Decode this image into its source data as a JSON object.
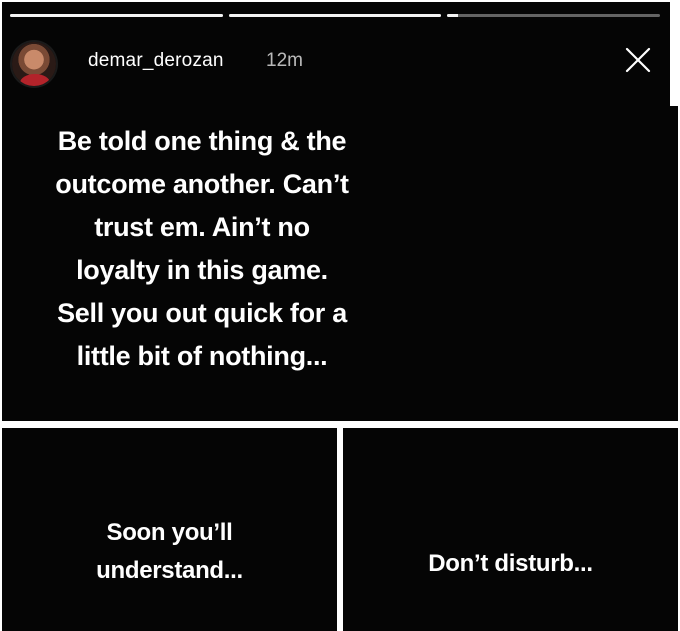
{
  "story": {
    "progress": [
      1.0,
      1.0,
      0.05
    ],
    "username": "demar_derozan",
    "timestamp": "12m",
    "avatar_icon": "profile-avatar",
    "close_icon": "close-x"
  },
  "panels": {
    "main_text": "Be told one thing & the\noutcome another. Can’t\ntrust em. Ain’t no\nloyalty in this game.\nSell you out quick for a\nlittle bit of nothing...",
    "left_text": "Soon you’ll\nunderstand...",
    "right_text": "Don’t disturb..."
  },
  "colors": {
    "background": "#050505",
    "text": "#ffffff",
    "divider": "#ffffff"
  }
}
